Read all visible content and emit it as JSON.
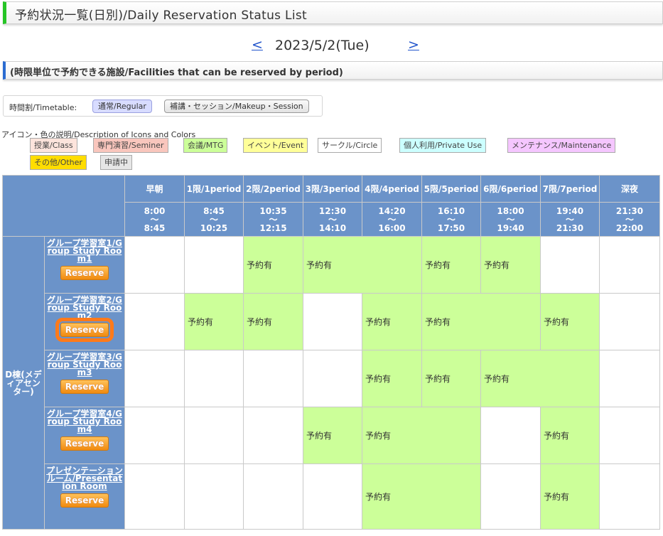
{
  "header": {
    "title": "予約状況一覧(日別)/Daily Reservation Status List"
  },
  "date_nav": {
    "prev": "<",
    "date": "2023/5/2(Tue)",
    "next": ">"
  },
  "section": {
    "title": "(時限単位で予約できる施設/Facilities that can be reserved by period)"
  },
  "timetable": {
    "label": "時間割/Timetable:",
    "regular": "通常/Regular",
    "makeup": "補講・セッション/Makeup・Session",
    "selected": "通常/Regular"
  },
  "legend": {
    "title": "アイコン・色の説明/Description of Icons and Colors",
    "items": [
      {
        "label": "授業/Class",
        "color": "#fde4dc"
      },
      {
        "label": "専門演習/Seminer",
        "color": "#f9c6bd"
      },
      {
        "label": "会議/MTG",
        "color": "#ccff99"
      },
      {
        "label": "イベント/Event",
        "color": "#ffff99"
      },
      {
        "label": "サークル/Circle",
        "color": "#ffffff"
      },
      {
        "label": "個人利用/Private Use",
        "color": "#ccffff"
      },
      {
        "label": "メンテナンス/Maintenance",
        "color": "#f5c6ff"
      },
      {
        "label": "その他/Other",
        "color": "#ffdd00"
      },
      {
        "label": "申請中",
        "color": "#e6e6e6"
      }
    ]
  },
  "periods": [
    {
      "name": "早朝",
      "start": "8:00",
      "sep": "～",
      "end": "8:45"
    },
    {
      "name": "1限/1period",
      "start": "8:45",
      "sep": "～",
      "end": "10:25"
    },
    {
      "name": "2限/2period",
      "start": "10:35",
      "sep": "～",
      "end": "12:15"
    },
    {
      "name": "3限/3period",
      "start": "12:30",
      "sep": "～",
      "end": "14:10"
    },
    {
      "name": "4限/4period",
      "start": "14:20",
      "sep": "～",
      "end": "16:00"
    },
    {
      "name": "5限/5period",
      "start": "16:10",
      "sep": "～",
      "end": "17:50"
    },
    {
      "name": "6限/6period",
      "start": "18:00",
      "sep": "～",
      "end": "19:40"
    },
    {
      "name": "7限/7period",
      "start": "19:40",
      "sep": "～",
      "end": "21:30"
    },
    {
      "name": "深夜",
      "start": "21:30",
      "sep": "～",
      "end": "22:00"
    }
  ],
  "building": "D棟(メディアセンター)",
  "reserve_label": "Reserve",
  "booked_label": "予約有",
  "rooms": [
    {
      "name": "グループ学習室1/Group Study Room1"
    },
    {
      "name": "グループ学習室2/Group Study Room2"
    },
    {
      "name": "グループ学習室3/Group Study Room3"
    },
    {
      "name": "グループ学習室4/Group Study Room4"
    },
    {
      "name": "プレゼンテーションルーム/Presentation Room"
    }
  ]
}
